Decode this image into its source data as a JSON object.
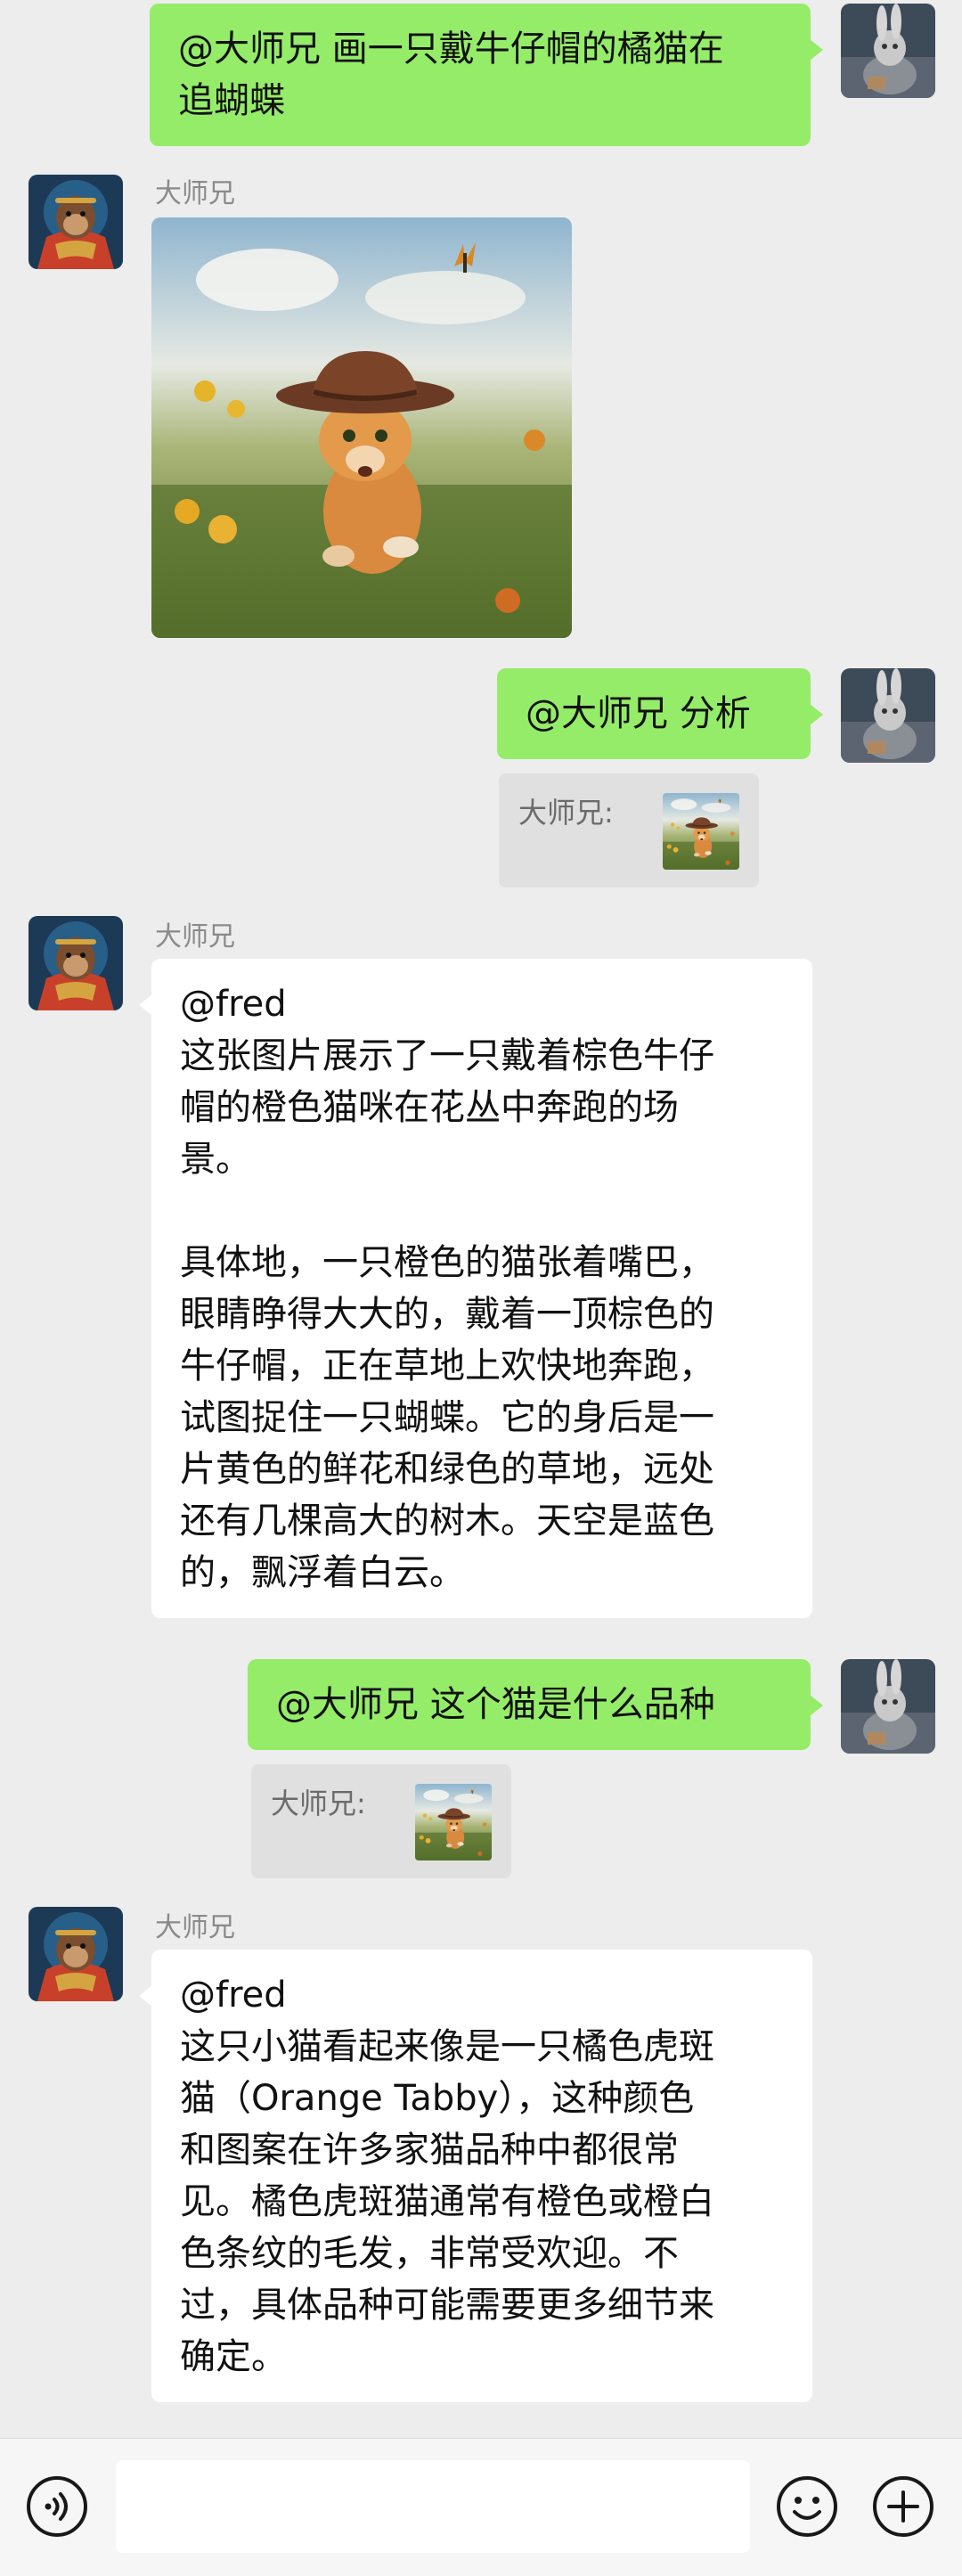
{
  "bot_name": "大师兄",
  "messages": [
    {
      "id": "m1",
      "text": "@大师兄 画一只戴牛仔帽的橘猫在\n追蝴蝶"
    },
    {
      "id": "m2",
      "sender": "大师兄",
      "image_alt": "戴牛仔帽的橘猫在花丛中追蝴蝶"
    },
    {
      "id": "m3",
      "text": "@大师兄 分析",
      "quote_label": "大师兄:"
    },
    {
      "id": "m4",
      "sender": "大师兄",
      "text": "@fred\n这张图片展示了一只戴着棕色牛仔\n帽的橙色猫咪在花丛中奔跑的场\n景。\n\n具体地，一只橙色的猫张着嘴巴，\n眼睛睁得大大的，戴着一顶棕色的\n牛仔帽，正在草地上欢快地奔跑，\n试图捉住一只蝴蝶。它的身后是一\n片黄色的鲜花和绿色的草地，远处\n还有几棵高大的树木。天空是蓝色\n的，飘浮着白云。"
    },
    {
      "id": "m5",
      "text": "@大师兄 这个猫是什么品种",
      "quote_label": "大师兄:"
    },
    {
      "id": "m6",
      "sender": "大师兄",
      "text": "@fred\n这只小猫看起来像是一只橘色虎斑\n猫（Orange Tabby），这种颜色\n和图案在许多家猫品种中都很常\n见。橘色虎斑猫通常有橙色或橙白\n色条纹的毛发，非常受欢迎。不\n过，具体品种可能需要更多细节来\n确定。"
    }
  ],
  "input": {
    "value": "",
    "placeholder": ""
  },
  "colors": {
    "sent_bubble": "#95ec69",
    "received_bubble": "#ffffff",
    "background": "#ededed"
  },
  "icons": {
    "voice": "voice-icon",
    "emoji": "emoji-icon",
    "plus": "plus-icon"
  }
}
